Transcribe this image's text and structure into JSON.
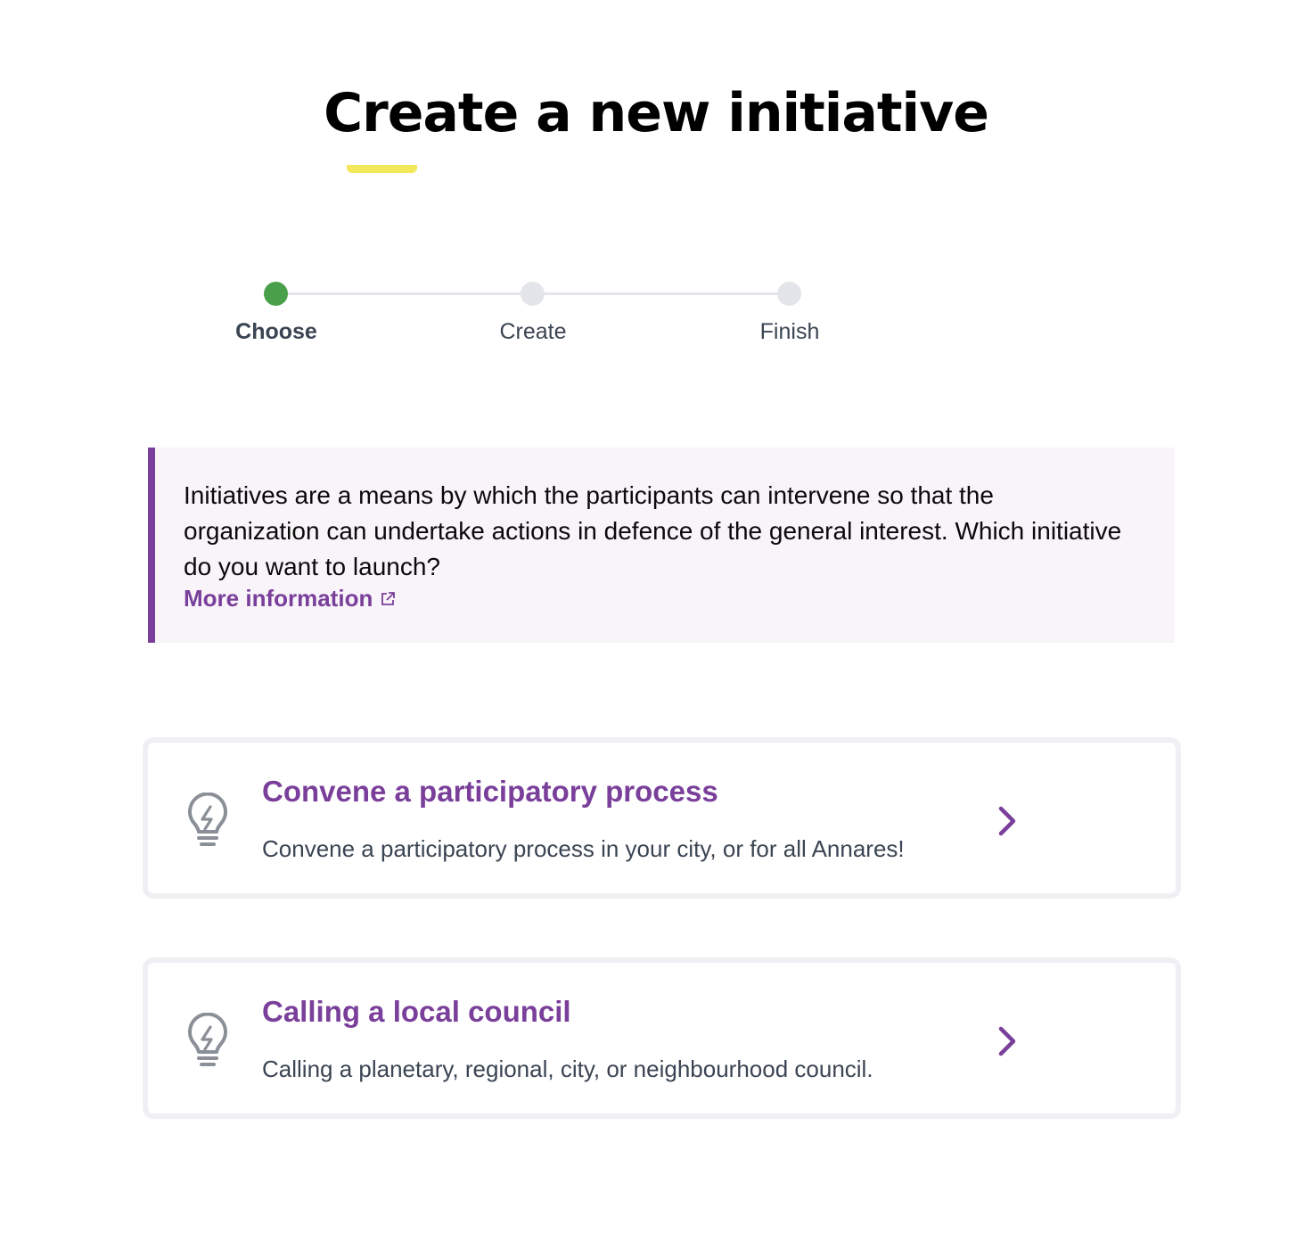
{
  "page": {
    "title": "Create a new initiative"
  },
  "stepper": {
    "steps": [
      {
        "label": "Choose",
        "state": "active"
      },
      {
        "label": "Create",
        "state": "pending"
      },
      {
        "label": "Finish",
        "state": "pending"
      }
    ]
  },
  "info": {
    "text": "Initiatives are a means by which the participants can intervene so that the organization can undertake actions in defence of the general interest. Which initiative do you want to launch?",
    "link_label": "More information",
    "link_icon": "external-link-icon"
  },
  "options": [
    {
      "title": "Convene a participatory process",
      "description": "Convene a participatory process in your city, or for all Annares!",
      "icon": "lightbulb-icon"
    },
    {
      "title": "Calling a local council",
      "description": "Calling a planetary, regional, city, or neighbourhood council.",
      "icon": "lightbulb-icon"
    }
  ],
  "colors": {
    "accent": "#7a3f9a",
    "title_underline": "#f2e85a",
    "step_active": "#4aa04a",
    "step_inactive": "#e3e5ea"
  }
}
